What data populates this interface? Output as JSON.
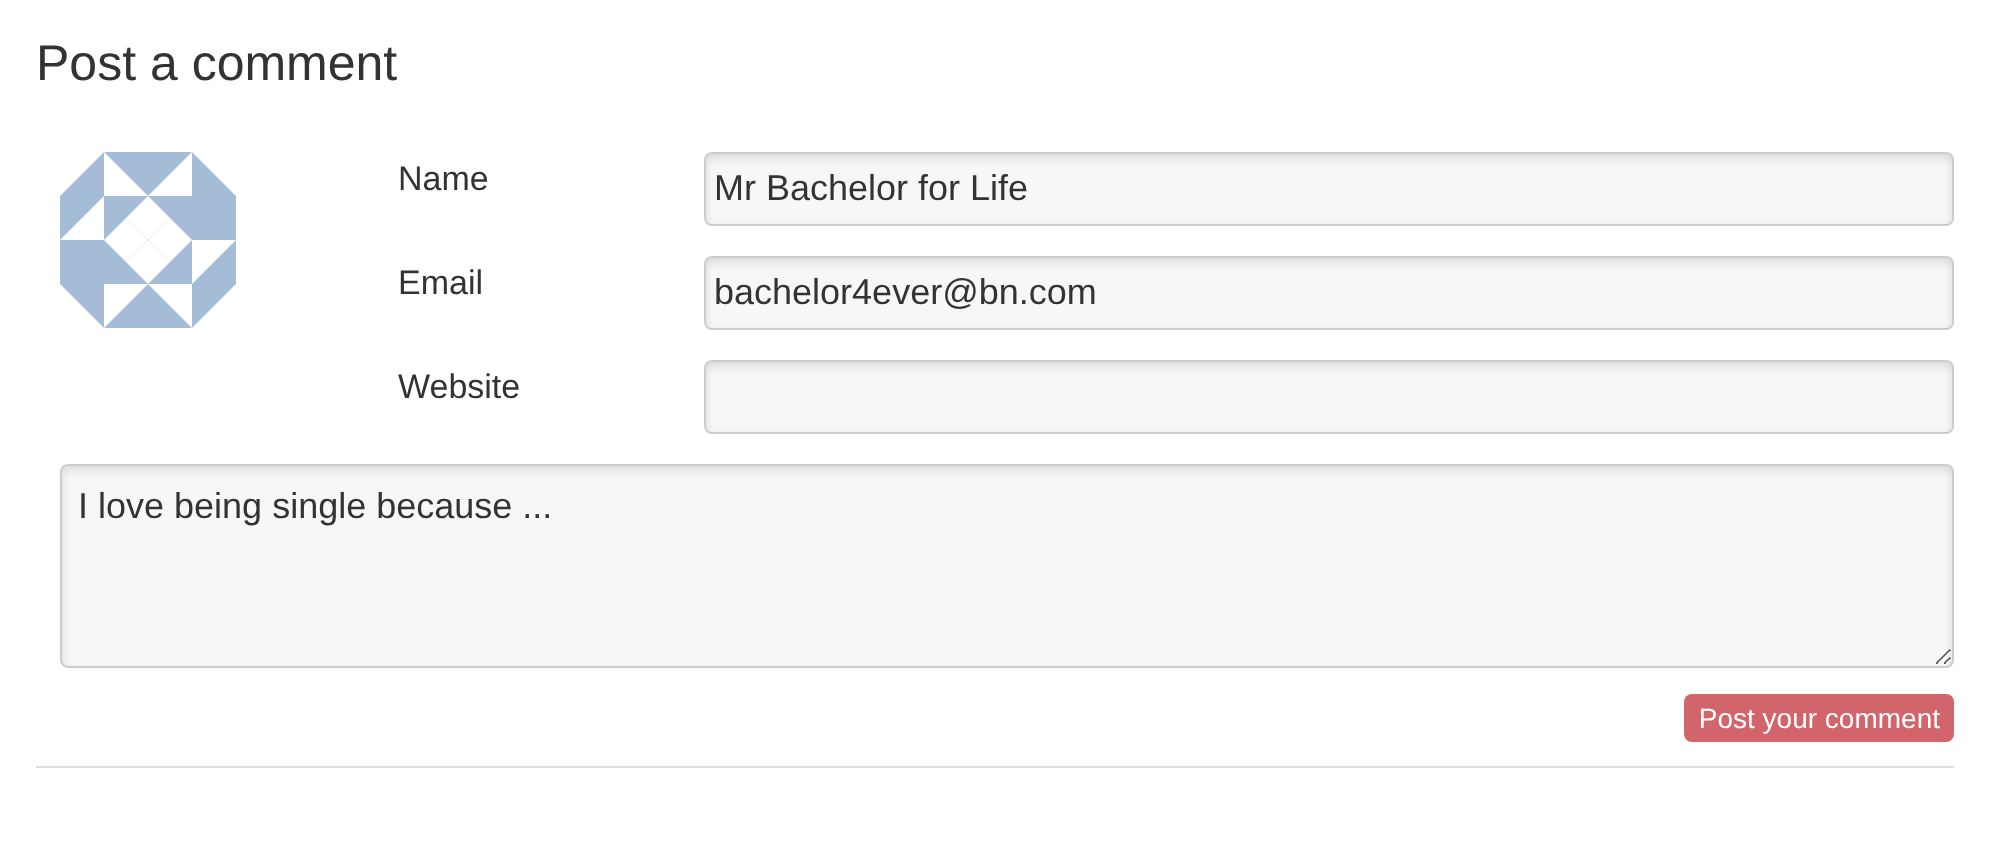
{
  "heading": "Post a comment",
  "fields": [
    {
      "label": "Name",
      "value": "Mr Bachelor for Life"
    },
    {
      "label": "Email",
      "value": "bachelor4ever@bn.com"
    },
    {
      "label": "Website"
    }
  ],
  "comment": {
    "value": "I love being single because ..."
  },
  "submit": {
    "label": "Post your comment"
  }
}
